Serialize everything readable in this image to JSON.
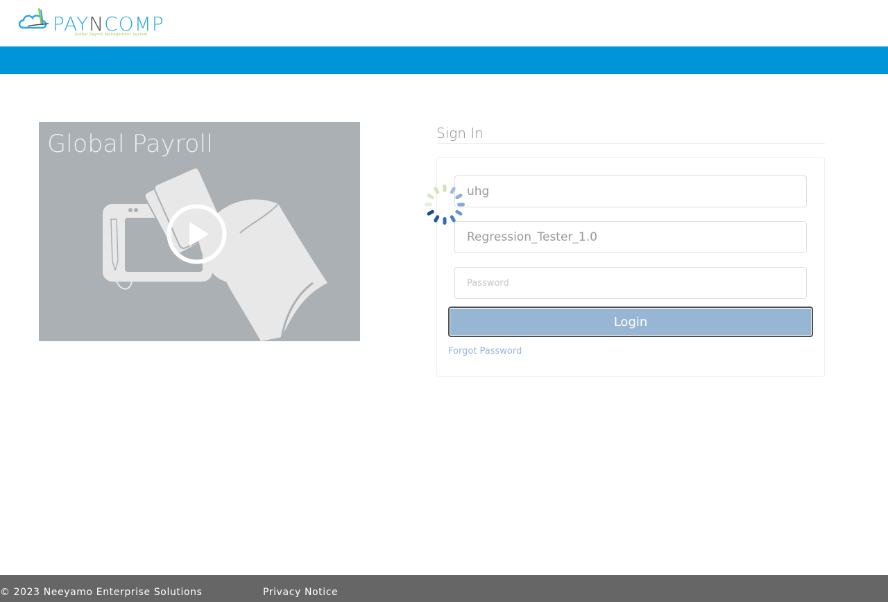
{
  "header": {
    "logo_pay": "PAY",
    "logo_n": "N",
    "logo_comp": "COMP",
    "logo_tagline": "Global Payroll Management System"
  },
  "promo": {
    "title": "Global Payroll",
    "play_icon": "play-icon"
  },
  "signin": {
    "title": "Sign In",
    "company_value": "uhg",
    "username_value": "Regression_Tester_1.0",
    "password_placeholder": "Password",
    "login_label": "Login",
    "forgot_label": "Forgot Password",
    "loading_icon": "loading-spinner-icon"
  },
  "footer": {
    "copyright": "© 2023 Neeyamo Enterprise Solutions",
    "privacy_label": "Privacy Notice"
  },
  "colors": {
    "brand_blue": "#0094d8",
    "logo_blue": "#29a9e0",
    "promo_bg": "#abb0b5",
    "login_button": "#97b6d4",
    "footer_bg": "#666666",
    "link": "#93b7dc"
  }
}
